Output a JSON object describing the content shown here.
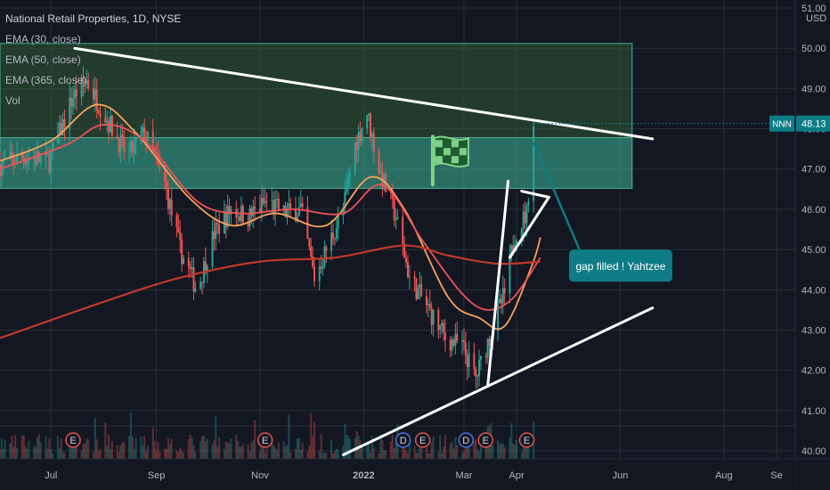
{
  "header": {
    "title": "National Retail Properties, 1D, NYSE",
    "indicators": [
      "EMA (30, close)",
      "EMA (50, close)",
      "EMA (365, close)",
      "Vol"
    ]
  },
  "colors": {
    "background": "#131722",
    "grid": "#2a2e39",
    "up": "#26a69a",
    "down": "#ef5350",
    "ema30": "#f9a25b",
    "ema50": "#f0515a",
    "ema365": "#c0392b",
    "zone_upper": "#2f5a36",
    "zone_lower": "#3aa88f",
    "annotation": "#0e7c86",
    "trendline": "#ffffff",
    "axis_text": "#b2b5be",
    "price_tag": "#0e7c86"
  },
  "chart_data": {
    "type": "candlestick",
    "symbol": "NNN",
    "currency": "USD",
    "last_price": "48.13",
    "ylim": [
      39.8,
      51.2
    ],
    "y_ticks": [
      "51.00",
      "50.00",
      "49.00",
      "48.00",
      "47.00",
      "46.00",
      "45.00",
      "44.00",
      "43.00",
      "42.00",
      "41.00",
      "40.00"
    ],
    "x_ticks": [
      "Jul",
      "Sep",
      "Nov",
      "2022",
      "Mar",
      "Apr",
      "Jun",
      "Aug",
      "Se"
    ],
    "zones": [
      {
        "from": 47.78,
        "to": 50.12
      },
      {
        "from": 46.52,
        "to": 47.78
      }
    ],
    "trendlines": [
      {
        "from": [
          "2021-07-15",
          50.0
        ],
        "to": [
          "2022-06-20",
          47.75
        ]
      },
      {
        "from": [
          "2021-12-20",
          39.9
        ],
        "to": [
          "2022-06-20",
          43.55
        ]
      },
      {
        "from": [
          "2022-03-15",
          41.6
        ],
        "to": [
          "2022-03-27",
          46.7
        ]
      },
      {
        "from": [
          "2022-03-28",
          44.8
        ],
        "to": [
          "2022-04-20",
          46.3
        ]
      },
      {
        "from": [
          "2022-04-04",
          46.45
        ],
        "to": [
          "2022-04-20",
          46.3
        ]
      },
      {
        "from": [
          "2022-04-11",
          47.65
        ],
        "to": [
          "2022-05-08",
          45.0
        ]
      }
    ],
    "annotation": {
      "text": "gap filled ! Yahtzee",
      "date": "2022-05-05",
      "price": 44.6
    },
    "flag_icon": {
      "date": "2022-02-18",
      "price": 47.1
    },
    "earnings_markers": [
      {
        "date": "2021-07-14",
        "labels": [
          "E"
        ]
      },
      {
        "date": "2021-11-04",
        "labels": [
          "E"
        ]
      },
      {
        "date": "2022-01-30",
        "labels": [
          "D",
          "E"
        ]
      },
      {
        "date": "2022-03-08",
        "labels": [
          "D",
          "E"
        ]
      },
      {
        "date": "2022-04-07",
        "labels": [
          "E"
        ]
      }
    ],
    "price_path": [
      [
        "2021-06-01",
        47.1
      ],
      [
        "2021-06-15",
        47.3
      ],
      [
        "2021-06-30",
        47.2
      ],
      [
        "2021-07-14",
        48.8
      ],
      [
        "2021-07-22",
        49.2
      ],
      [
        "2021-08-01",
        48.4
      ],
      [
        "2021-08-15",
        47.3
      ],
      [
        "2021-08-25",
        47.9
      ],
      [
        "2021-09-05",
        46.8
      ],
      [
        "2021-09-15",
        45.0
      ],
      [
        "2021-09-25",
        44.0
      ],
      [
        "2021-10-05",
        45.4
      ],
      [
        "2021-10-15",
        46.0
      ],
      [
        "2021-10-25",
        45.8
      ],
      [
        "2021-11-05",
        46.2
      ],
      [
        "2021-11-15",
        45.9
      ],
      [
        "2021-11-25",
        46.0
      ],
      [
        "2021-12-03",
        44.3
      ],
      [
        "2021-12-12",
        45.2
      ],
      [
        "2021-12-20",
        46.0
      ],
      [
        "2021-12-27",
        47.6
      ],
      [
        "2022-01-03",
        48.4
      ],
      [
        "2022-01-10",
        47.0
      ],
      [
        "2022-01-20",
        45.8
      ],
      [
        "2022-01-28",
        44.3
      ],
      [
        "2022-02-07",
        43.6
      ],
      [
        "2022-02-18",
        42.8
      ],
      [
        "2022-02-28",
        42.6
      ],
      [
        "2022-03-08",
        41.8
      ],
      [
        "2022-03-18",
        43.1
      ],
      [
        "2022-03-25",
        43.9
      ],
      [
        "2022-03-31",
        45.4
      ],
      [
        "2022-04-07",
        45.9
      ],
      [
        "2022-04-11",
        48.13
      ]
    ],
    "ema_series": [
      {
        "name": "EMA (30, close)",
        "points": [
          [
            "2021-06-01",
            47.2
          ],
          [
            "2021-07-01",
            47.7
          ],
          [
            "2021-07-28",
            48.6
          ],
          [
            "2021-08-20",
            47.9
          ],
          [
            "2021-09-20",
            46.3
          ],
          [
            "2021-10-15",
            45.6
          ],
          [
            "2021-11-10",
            45.9
          ],
          [
            "2021-12-10",
            45.6
          ],
          [
            "2022-01-05",
            46.8
          ],
          [
            "2022-01-25",
            46.0
          ],
          [
            "2022-02-20",
            43.8
          ],
          [
            "2022-03-10",
            43.3
          ],
          [
            "2022-03-25",
            43.1
          ],
          [
            "2022-04-10",
            44.6
          ],
          [
            "2022-04-15",
            45.3
          ]
        ]
      },
      {
        "name": "EMA (50, close)",
        "points": [
          [
            "2021-06-01",
            47.0
          ],
          [
            "2021-07-10",
            47.6
          ],
          [
            "2021-08-01",
            48.1
          ],
          [
            "2021-08-25",
            47.7
          ],
          [
            "2021-09-25",
            46.2
          ],
          [
            "2021-10-20",
            45.9
          ],
          [
            "2021-11-20",
            46.0
          ],
          [
            "2021-12-20",
            45.9
          ],
          [
            "2022-01-12",
            46.6
          ],
          [
            "2022-02-05",
            45.2
          ],
          [
            "2022-02-28",
            43.9
          ],
          [
            "2022-03-15",
            43.5
          ],
          [
            "2022-03-30",
            43.8
          ],
          [
            "2022-04-15",
            44.8
          ]
        ]
      },
      {
        "name": "EMA (365, close)",
        "points": [
          [
            "2021-06-01",
            42.8
          ],
          [
            "2021-08-01",
            43.7
          ],
          [
            "2021-09-15",
            44.3
          ],
          [
            "2021-11-01",
            44.7
          ],
          [
            "2021-12-15",
            44.8
          ],
          [
            "2022-01-25",
            45.1
          ],
          [
            "2022-02-20",
            44.85
          ],
          [
            "2022-03-20",
            44.65
          ],
          [
            "2022-04-15",
            44.7
          ]
        ]
      }
    ]
  }
}
